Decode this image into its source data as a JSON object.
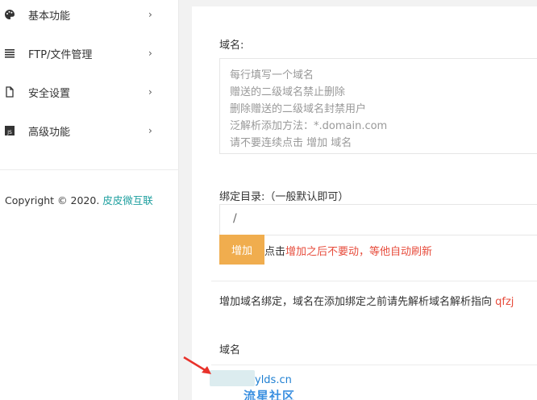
{
  "sidebar": {
    "items": [
      {
        "label": "基本功能",
        "icon": "palette-icon",
        "chevron": "›"
      },
      {
        "label": "FTP/文件管理",
        "icon": "list-icon",
        "chevron": "›"
      },
      {
        "label": "安全设置",
        "icon": "file-icon",
        "chevron": "›"
      },
      {
        "label": "高级功能",
        "icon": "js-icon",
        "chevron": "›"
      }
    ],
    "copyright_prefix": "Copyright © 2020.",
    "copyright_brand": "皮皮微互联"
  },
  "form": {
    "domain_label": "域名:",
    "domain_placeholder_lines": [
      "每行填写一个域名",
      "赠送的二级域名禁止删除",
      "删除赠送的二级域名封禁用户",
      "泛解析添加方法：*.domain.com",
      "请不要连续点击 增加 域名"
    ],
    "dir_label": "绑定目录:（一般默认即可）",
    "dir_value": "/",
    "add_button": "增加",
    "hint_prefix": "点击",
    "hint_red": "增加之后不要动，等他自动刷新"
  },
  "bindings": {
    "note_prefix": "增加域名绑定，域名在添加绑定之前请先解析域名解析指向",
    "note_red": "qfzj",
    "column_header": "域名",
    "rows": [
      {
        "domain": "ylds.cn"
      }
    ]
  },
  "watermark": "流星社区",
  "colors": {
    "accent_button": "#f0ad4e",
    "warning_text": "#e74c3c",
    "brand": "#20a0a0",
    "link": "#1e7fd2"
  }
}
